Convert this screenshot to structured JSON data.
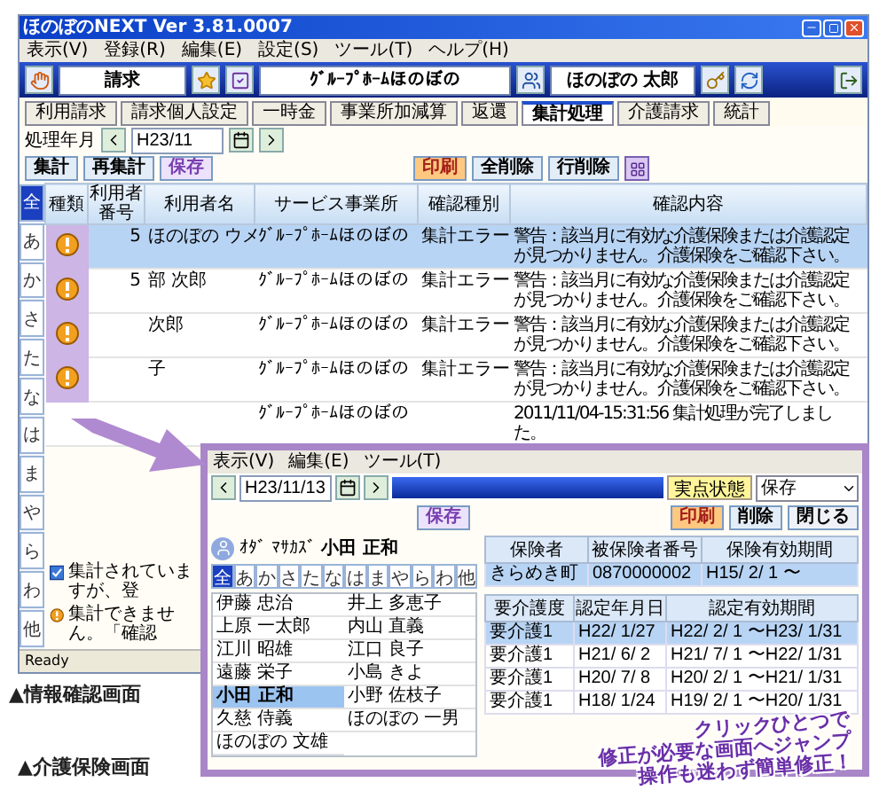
{
  "main_window": {
    "title": "ほのぼのNEXT Ver 3.81.0007",
    "menu": [
      "表示(V)",
      "登録(R)",
      "編集(E)",
      "設定(S)",
      "ツール(T)",
      "ヘルプ(H)"
    ],
    "toolbar": {
      "section": "請求",
      "facility": "ｸﾞﾙｰﾌﾟﾎｰﾑほのぼの",
      "user": "ほのぼの 太郎"
    },
    "tabs": [
      {
        "label": "利用請求",
        "selected": false
      },
      {
        "label": "請求個人設定",
        "selected": false
      },
      {
        "label": "一時金",
        "selected": false
      },
      {
        "label": "事業所加減算",
        "selected": false
      },
      {
        "label": "返還",
        "selected": false
      },
      {
        "label": "集計処理",
        "selected": true
      },
      {
        "label": "介護請求",
        "selected": false
      },
      {
        "label": "統計",
        "selected": false
      }
    ],
    "period": {
      "label": "処理年月",
      "value": "H23/11"
    },
    "actions": [
      {
        "label": "集計",
        "kind": "plain"
      },
      {
        "label": "再集計",
        "kind": "plain"
      },
      {
        "label": "保存",
        "kind": "save"
      },
      {
        "label": "印刷",
        "kind": "print"
      },
      {
        "label": "全削除",
        "kind": "plain"
      },
      {
        "label": "行削除",
        "kind": "plain"
      }
    ],
    "kana_index": [
      {
        "label": "全",
        "selected": true
      },
      {
        "label": "あ",
        "selected": false
      },
      {
        "label": "か",
        "selected": false
      },
      {
        "label": "さ",
        "selected": false
      },
      {
        "label": "た",
        "selected": false
      },
      {
        "label": "な",
        "selected": false
      },
      {
        "label": "は",
        "selected": false
      },
      {
        "label": "ま",
        "selected": false
      },
      {
        "label": "や",
        "selected": false
      },
      {
        "label": "ら",
        "selected": false
      },
      {
        "label": "わ",
        "selected": false
      },
      {
        "label": "他",
        "selected": false
      }
    ],
    "table": {
      "columns": [
        "種類",
        "利用者番号",
        "利用者名",
        "サービス事業所",
        "確認種別",
        "確認内容"
      ],
      "rows": [
        {
          "flagged": true,
          "selected": true,
          "number": "5",
          "name": "ほのぼの ウメ",
          "office": "ｸﾞﾙｰﾌﾟﾎｰﾑほのぼの",
          "check_type": "集計エラー",
          "message": "警告：該当月に有効な介護保険または介護認定が見つかりません。介護保険をご確認下さい。"
        },
        {
          "flagged": true,
          "selected": false,
          "number": "5",
          "name": "部 次郎",
          "office": "ｸﾞﾙｰﾌﾟﾎｰﾑほのぼの",
          "check_type": "集計エラー",
          "message": "警告：該当月に有効な介護保険または介護認定が見つかりません。介護保険をご確認下さい。"
        },
        {
          "flagged": true,
          "selected": false,
          "name": "次郎",
          "office": "ｸﾞﾙｰﾌﾟﾎｰﾑほのぼの",
          "check_type": "集計エラー",
          "message": "警告：該当月に有効な介護保険または介護認定が見つかりません。介護保険をご確認下さい。"
        },
        {
          "flagged": true,
          "selected": false,
          "name": "子",
          "office": "ｸﾞﾙｰﾌﾟﾎｰﾑほのぼの",
          "check_type": "集計エラー",
          "message": "警告：該当月に有効な介護保険または介護認定が見つかりません。介護保険をご確認下さい。"
        },
        {
          "flagged": false,
          "selected": false,
          "office": "ｸﾞﾙｰﾌﾟﾎｰﾑほのぼの",
          "message": "2011/11/04-15:31:56 集計処理が完了しました。"
        }
      ]
    },
    "legend": [
      {
        "kind": "info",
        "text": "集計されていますが、登"
      },
      {
        "kind": "warning",
        "text": "集計できません。「確認"
      }
    ],
    "status_bar": "Ready"
  },
  "main_caption": "▲情報確認画面",
  "detail_window": {
    "menu": [
      "表示(V)",
      "編集(E)",
      "ツール(T)"
    ],
    "date": "H23/11/13",
    "status_button": "実点状態",
    "dropdown": "保存",
    "actions": [
      {
        "label": "保存",
        "kind": "save"
      },
      {
        "label": "印刷",
        "kind": "print"
      },
      {
        "label": "削除",
        "kind": "plain"
      },
      {
        "label": "閉じる",
        "kind": "close"
      }
    ],
    "person": {
      "kana": "ｵﾀﾞ ﾏｻｶｽﾞ",
      "name": "小田 正和"
    },
    "kana_index": [
      {
        "label": "全",
        "selected": true
      },
      {
        "label": "あ",
        "selected": false
      },
      {
        "label": "か",
        "selected": false
      },
      {
        "label": "さ",
        "selected": false
      },
      {
        "label": "た",
        "selected": false
      },
      {
        "label": "な",
        "selected": false
      },
      {
        "label": "は",
        "selected": false
      },
      {
        "label": "ま",
        "selected": false
      },
      {
        "label": "や",
        "selected": false
      },
      {
        "label": "ら",
        "selected": false
      },
      {
        "label": "わ",
        "selected": false
      },
      {
        "label": "他",
        "selected": false
      }
    ],
    "residents": [
      {
        "name": "伊藤 忠治",
        "selected": false
      },
      {
        "name": "井上 多恵子",
        "selected": false
      },
      {
        "name": "上原 一太郎",
        "selected": false
      },
      {
        "name": "内山 直義",
        "selected": false
      },
      {
        "name": "江川 昭雄",
        "selected": false
      },
      {
        "name": "江口 良子",
        "selected": false
      },
      {
        "name": "遠藤 栄子",
        "selected": false
      },
      {
        "name": "小島 きよ",
        "selected": false
      },
      {
        "name": "小田 正和",
        "selected": true
      },
      {
        "name": "小野 佐枝子",
        "selected": false
      },
      {
        "name": "久慈 侍義",
        "selected": false
      },
      {
        "name": "ほのぼの 一男",
        "selected": false
      },
      {
        "name": "ほのぼの 文雄",
        "selected": false
      }
    ],
    "insurance": {
      "columns": [
        "保険者",
        "被保険者番号",
        "保険有効期間"
      ],
      "rows": [
        {
          "selected": true,
          "cells": [
            "きらめき町",
            "0870000002",
            "H15/ 2/ 1 〜"
          ]
        }
      ]
    },
    "certifications": {
      "columns": [
        "要介護度",
        "認定年月日",
        "認定有効期間"
      ],
      "rows": [
        {
          "selected": true,
          "cells": [
            "要介護1",
            "H22/ 1/27",
            "H22/ 2/ 1 〜H23/ 1/31"
          ]
        },
        {
          "selected": false,
          "cells": [
            "要介護1",
            "H21/ 6/ 2",
            "H21/ 7/ 1 〜H22/ 1/31"
          ]
        },
        {
          "selected": false,
          "cells": [
            "要介護1",
            "H20/ 7/ 8",
            "H20/ 2/ 1 〜H21/ 1/31"
          ]
        },
        {
          "selected": false,
          "cells": [
            "要介護1",
            "H18/ 1/24",
            "H19/ 2/ 1 〜H20/ 1/31"
          ]
        }
      ]
    }
  },
  "detail_caption": "▲介護保険画面",
  "slogan": [
    "クリックひとつで",
    "修正が必要な画面へジャンプ",
    "操作も迷わず簡単修正！"
  ]
}
